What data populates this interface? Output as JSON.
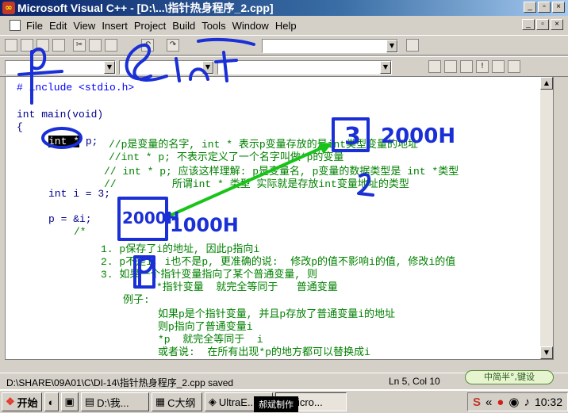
{
  "window": {
    "title": "Microsoft Visual C++ - [D:\\...\\指针热身程序_2.cpp]",
    "minimize": "_",
    "restore": "▫",
    "close": "×"
  },
  "menu": [
    "File",
    "Edit",
    "View",
    "Insert",
    "Project",
    "Build",
    "Tools",
    "Window",
    "Help"
  ],
  "code": {
    "line1": "# include <stdio.h>",
    "line2": "int main(void)",
    "line3": "{",
    "decl_sel": "int *",
    "decl_rest": " p;",
    "c1": "//p是变量的名字, int * 表示p变量存放的是int类型变量的地址",
    "c2": "//int * p; 不表示定义了一个名字叫做*p的变量",
    "c3": "// int * p; 应该这样理解: p是变量名, p变量的数据类型是 int *类型",
    "c4": "//         所谓int * 类型 实际就是存放int变量地址的类型",
    "line_i": "int i = 3;",
    "line_p": "p = &i;",
    "open_comment": "/*",
    "n1": "1. p保存了i的地址, 因此p指向i",
    "n2": "2. p不是i, i也不是p, 更准确的说:  修改p的值不影响i的值, 修改i的值",
    "n3": "3. 如果一个指针变量指向了某个普通变量, 则",
    "n3b": "*指针变量  就完全等同于   普通变量",
    "ex": "例子:",
    "ex1": "如果p是个指针变量, 并且p存放了普通变量i的地址",
    "ex2": "则p指向了普通变量i",
    "ex3": "*p  就完全等同于  i",
    "ex4": "或者说:  在所有出现*p的地方都可以替换成i"
  },
  "annotations": {
    "p_label": "p",
    "amp_int": "&int",
    "box_value": "3",
    "addr_2000": "2000H",
    "addr_1000": "1000H",
    "digit_2": "2",
    "p_box": "p"
  },
  "status": {
    "file": "D:\\SHARE\\09A01\\C\\DI-14\\指针热身程序_2.cpp saved",
    "position": "Ln 5, Col 10",
    "ime": "中简半°,键设"
  },
  "taskbar": {
    "start": "开始",
    "items": [
      "D:\\我...",
      "C大纲",
      "UltraE...",
      "Micro..."
    ],
    "clock": "10:32",
    "rec_badge": "郝斌制作"
  },
  "colors": {
    "ink_blue": "#1a2fd6",
    "arrow_green": "#18c418",
    "titlebar": "#0a246a"
  }
}
